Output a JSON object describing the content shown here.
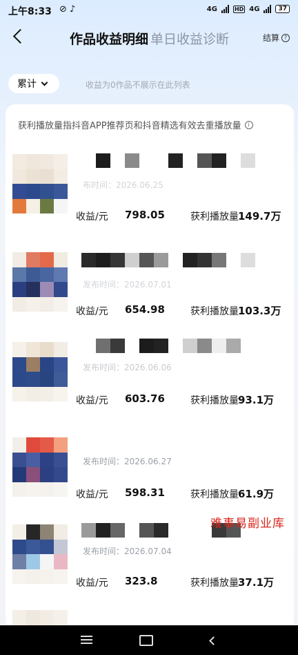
{
  "status_bar": {
    "time": "上午8:33",
    "icons": "⊘ ♪",
    "sig1": "4G",
    "hd": "HD",
    "sig2": "4G",
    "battery": "37"
  },
  "header": {
    "title": "作品收益明细",
    "subtitle": "单日收益诊断",
    "settle_label": "结算"
  },
  "filter": {
    "label": "累计",
    "note": "收益为0作品不展示在此列表"
  },
  "card": {
    "info": "获利播放量指抖音APP推荐页和抖音精选有效去重播放量"
  },
  "items": [
    {
      "pubtime": "布时间：2026.06.25",
      "earn_label": "收益/元",
      "earn": "798.05",
      "play_label": "获利播放量",
      "plays": "149.7万"
    },
    {
      "pubtime": "发布时间：2026.07.01",
      "earn_label": "收益/元",
      "earn": "654.98",
      "play_label": "获利播放量",
      "plays": "103.3万"
    },
    {
      "pubtime": "发布时间：2026.06.06",
      "earn_label": "收益/元",
      "earn": "603.76",
      "play_label": "获利播放量",
      "plays": "93.1万"
    },
    {
      "pubtime": "发布时间：2026.06.27",
      "earn_label": "收益/元",
      "earn": "598.31",
      "play_label": "获利播放量",
      "plays": "61.9万"
    },
    {
      "pubtime": "发布时间：2026.07.04",
      "earn_label": "收益/元",
      "earn": "323.8",
      "play_label": "获利播放量",
      "plays": "37.1万"
    }
  ],
  "watermark": "难事易副业库"
}
